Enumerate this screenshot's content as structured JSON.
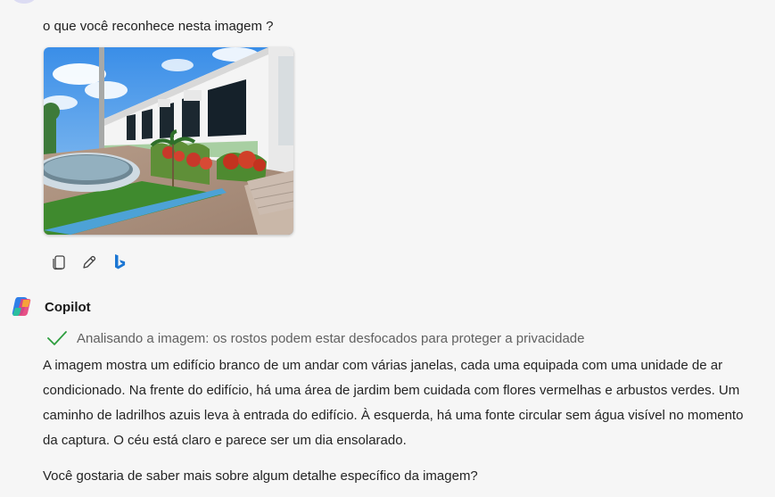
{
  "conversation": {
    "user_message": {
      "text": "o que você reconhece nesta imagem ?",
      "actions": [
        {
          "icon": "copy-icon"
        },
        {
          "icon": "edit-icon"
        },
        {
          "icon": "bing-icon"
        }
      ]
    },
    "bot": {
      "name": "Copilot",
      "icon": "copilot-logo",
      "status": "Analisando a imagem: os rostos podem estar desfocados para proteger a privacidade",
      "status_icon": "checkmark-icon",
      "answer": "A imagem mostra um edifício branco de um andar com várias janelas, cada uma equipada com uma unidade de ar condicionado. Na frente do edifício, há uma área de jardim bem cuidada com flores vermelhas e arbustos verdes. Um caminho de ladrilhos azuis leva à entrada do edifício. À esquerda, há uma fonte circular sem água visível no momento da captura. O céu está claro e parece ser um dia ensolarado.",
      "followup": "Você gostaria de saber mais sobre algum detalhe específico da imagem?"
    }
  },
  "colors": {
    "background": "#f6f6f6",
    "check": "#2e9e3f",
    "bing_blue": "#1b76d3"
  }
}
